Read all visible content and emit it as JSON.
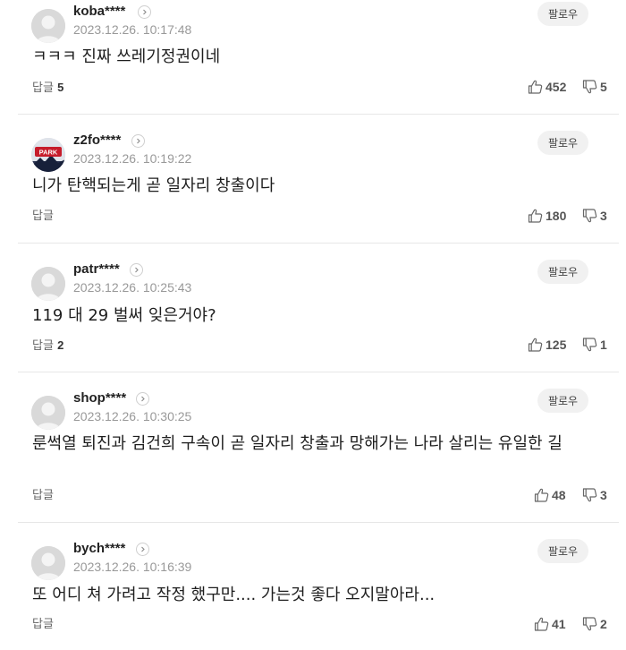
{
  "comments": [
    {
      "nickname": "koba****",
      "date": "2023.12.26. 10:17:48",
      "body": "ㅋㅋㅋ 진짜 쓰레기정권이네",
      "reply_label": "답글",
      "reply_count": "5",
      "likes": "452",
      "dislikes": "5",
      "follow_label": "팔로우",
      "avatar": "default-avatar"
    },
    {
      "nickname": "z2fo****",
      "date": "2023.12.26. 10:19:22",
      "body": "니가 탄핵되는게 곧 일자리 창출이다",
      "reply_label": "답글",
      "reply_count": "",
      "likes": "180",
      "dislikes": "3",
      "follow_label": "팔로우",
      "avatar": "park-avatar",
      "avatar_text": "PARK"
    },
    {
      "nickname": "patr****",
      "date": "2023.12.26. 10:25:43",
      "body": "119 대 29 벌써 잊은거야?",
      "reply_label": "답글",
      "reply_count": "2",
      "likes": "125",
      "dislikes": "1",
      "follow_label": "팔로우",
      "avatar": "default-avatar"
    },
    {
      "nickname": "shop****",
      "date": "2023.12.26. 10:30:25",
      "body": "룬썩열 퇴진과 김건희 구속이 곧 일자리 창출과 망해가는 나라 살리는 유일한 길",
      "reply_label": "답글",
      "reply_count": "",
      "likes": "48",
      "dislikes": "3",
      "follow_label": "팔로우",
      "avatar": "default-avatar"
    },
    {
      "nickname": "bych****",
      "date": "2023.12.26. 10:16:39",
      "body": "또 어디 쳐 가려고 작정 했구만.... 가는것 좋다 오지말아라...",
      "reply_label": "답글",
      "reply_count": "",
      "likes": "41",
      "dislikes": "2",
      "follow_label": "팔로우",
      "avatar": "default-avatar"
    }
  ],
  "colors": {
    "nickname": "#222222",
    "date": "#999999",
    "follow_bg": "#f1f1f1",
    "divider": "#e7e7e7"
  },
  "icons": {
    "like": "thumbs-up-icon",
    "dislike": "thumbs-down-icon",
    "profile_arrow": "chevron-right-icon"
  }
}
